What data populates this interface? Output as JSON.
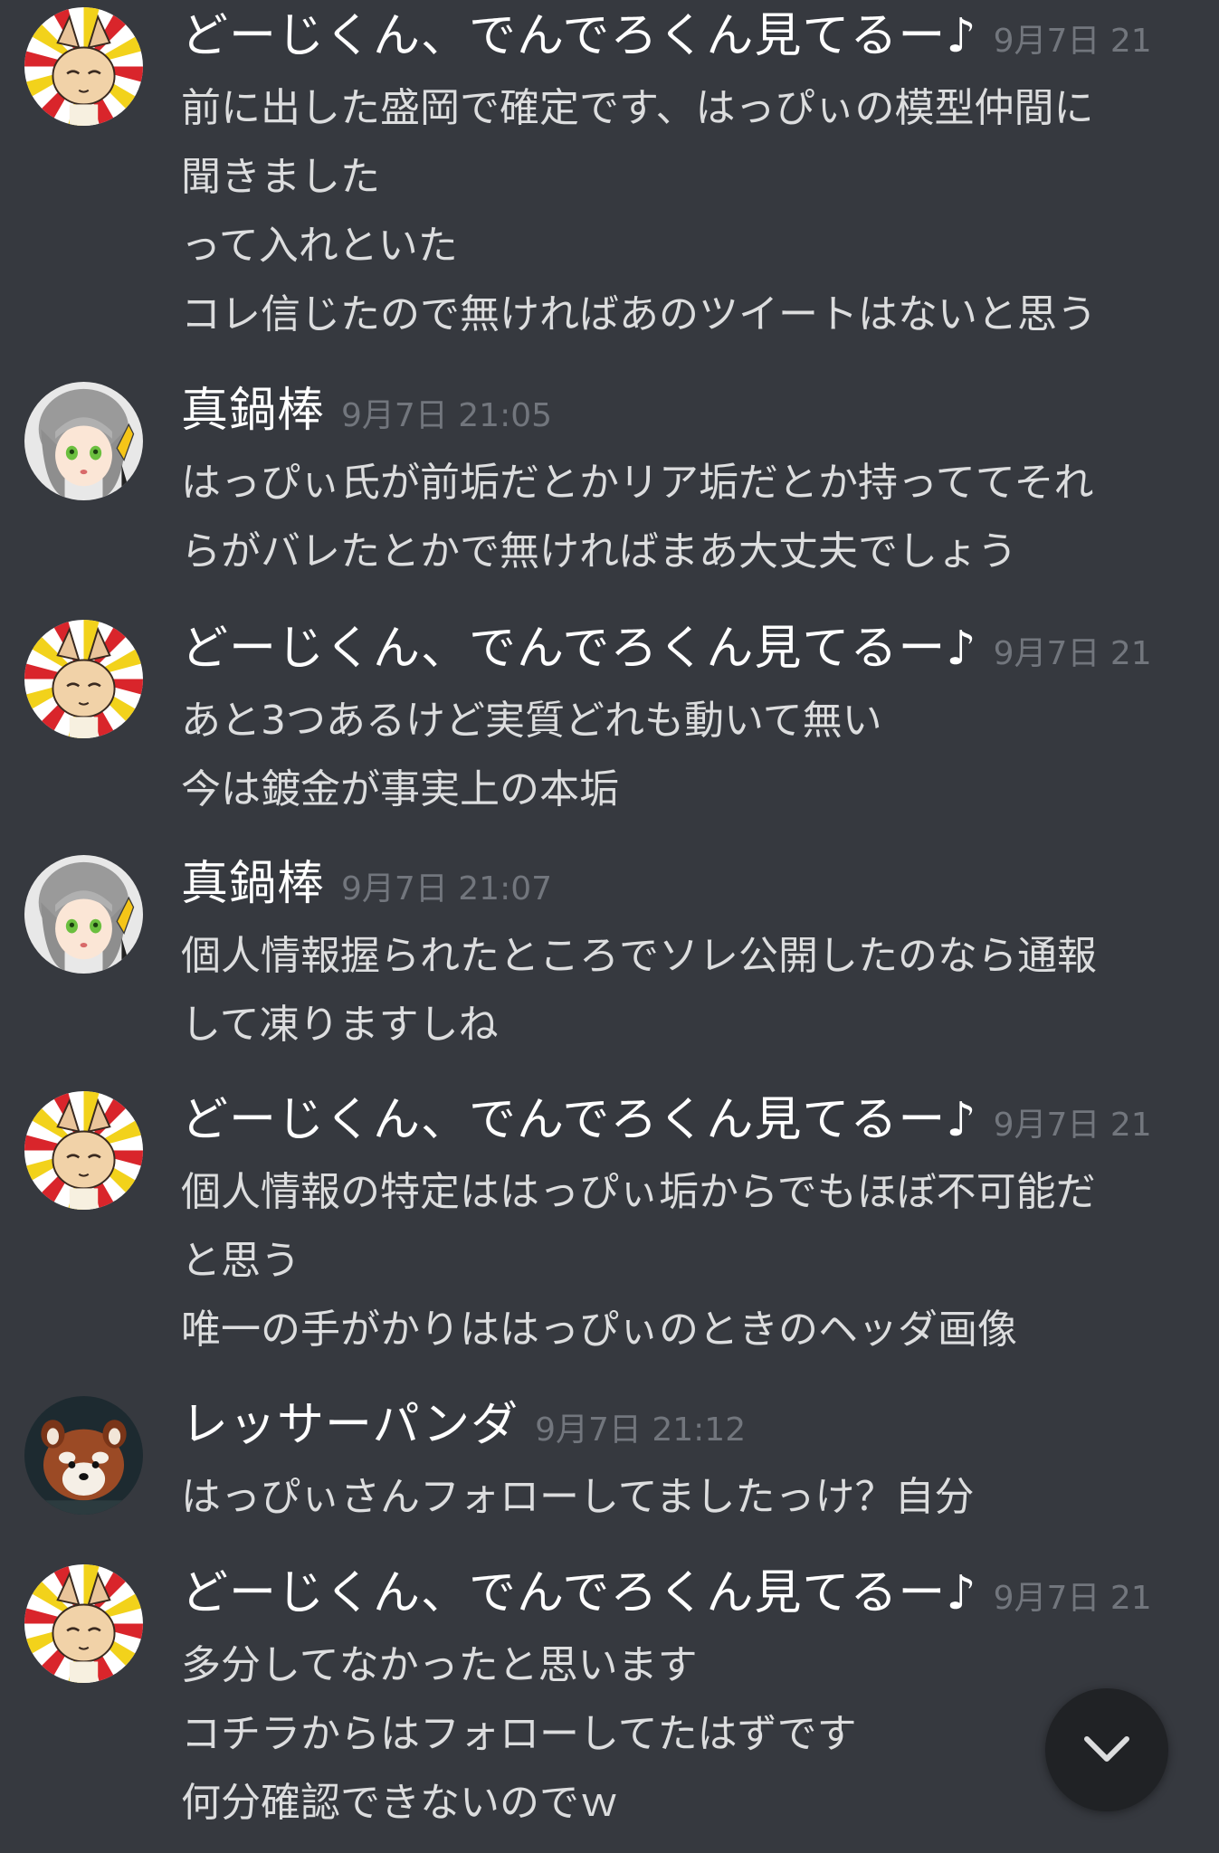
{
  "messages": [
    {
      "author": "どーじくん、でんでろくん見てるー♪",
      "avatar": "fox-avatar",
      "time": "9月7日 21",
      "lines": [
        "前に出した盛岡で確定です、はっぴぃの模型仲間に",
        "聞きました",
        "って入れといた",
        "コレ信じたので無ければあのツイートはないと思う"
      ]
    },
    {
      "author": "真鍋棒",
      "avatar": "silver-hair-avatar",
      "time": "9月7日 21:05",
      "lines": [
        "はっぴぃ氏が前垢だとかリア垢だとか持っててそれ",
        "らがバレたとかで無ければまあ大丈夫でしょう"
      ]
    },
    {
      "author": "どーじくん、でんでろくん見てるー♪",
      "avatar": "fox-avatar",
      "time": "9月7日 21",
      "lines": [
        "あと3つあるけど実質どれも動いて無い",
        "今は鍍金が事実上の本垢"
      ]
    },
    {
      "author": "真鍋棒",
      "avatar": "silver-hair-avatar",
      "time": "9月7日 21:07",
      "lines": [
        "個人情報握られたところでソレ公開したのなら通報",
        "して凍りますしね"
      ]
    },
    {
      "author": "どーじくん、でんでろくん見てるー♪",
      "avatar": "fox-avatar",
      "time": "9月7日 21",
      "lines": [
        "個人情報の特定ははっぴぃ垢からでもほぼ不可能だ",
        "と思う",
        "唯一の手がかりははっぴぃのときのヘッダ画像"
      ]
    },
    {
      "author": "レッサーパンダ",
      "avatar": "red-panda-avatar",
      "time": "9月7日 21:12",
      "lines": [
        "はっぴぃさんフォローしてましたっけ？自分"
      ]
    },
    {
      "author": "どーじくん、でんでろくん見てるー♪",
      "avatar": "fox-avatar",
      "time": "9月7日 21",
      "lines": [
        "多分してなかったと思います",
        "コチラからはフォローしてたはずです",
        "何分確認できないのでｗ"
      ]
    }
  ],
  "scroll_button": {
    "icon": "chevron-down-icon"
  },
  "colors": {
    "background": "#36393f",
    "username": "#ffffff",
    "text": "#dcddde",
    "timestamp": "#72767d",
    "scroll_button": "#202225"
  }
}
